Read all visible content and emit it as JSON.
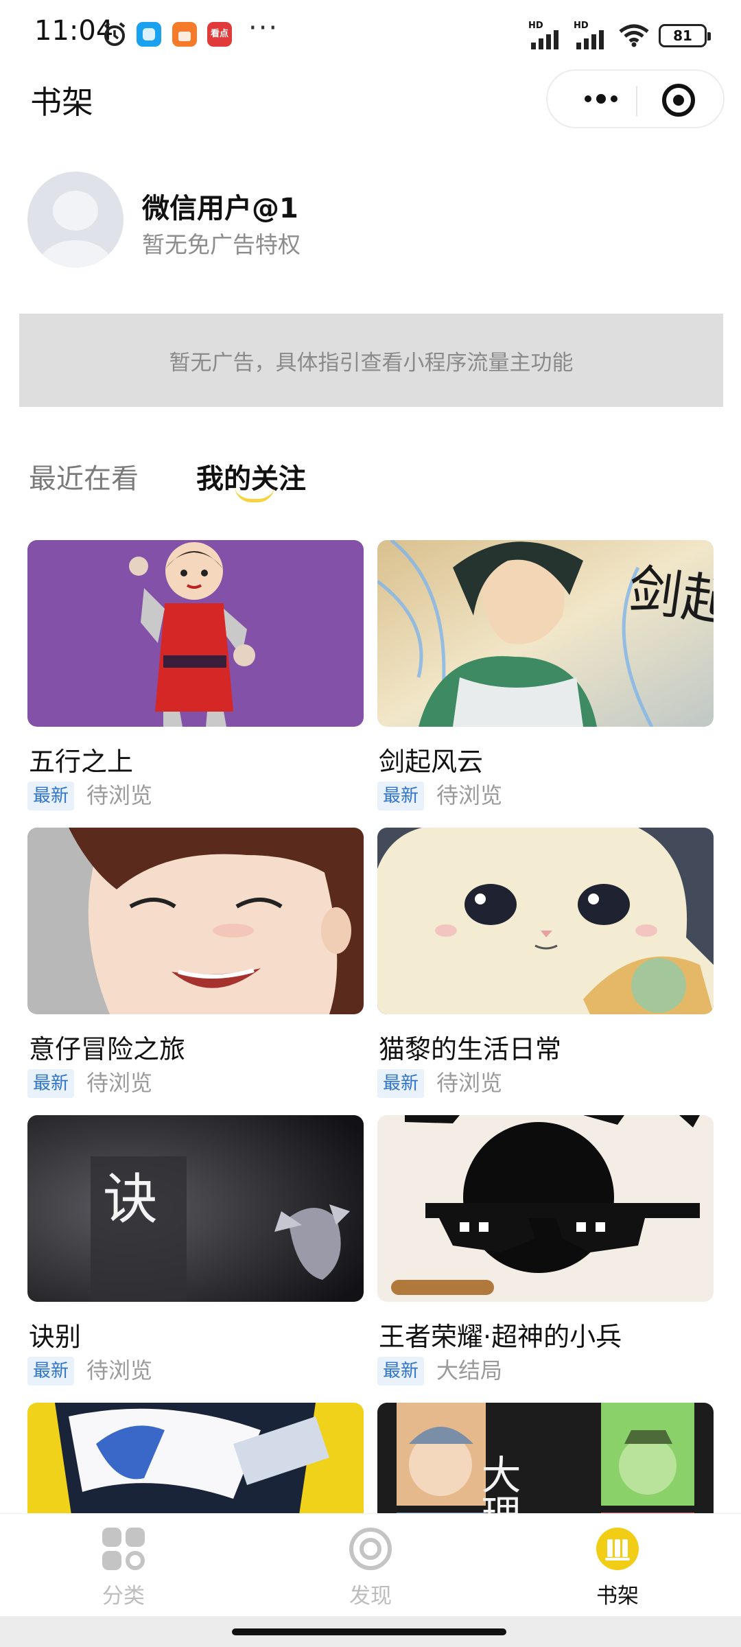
{
  "status_bar": {
    "time": "11:04",
    "battery": "81",
    "network_1": "HD",
    "network_2": "HD",
    "app_icons": [
      "alarm-icon",
      "app-blue-icon",
      "shopping-bag-icon",
      "kandian-app-icon"
    ],
    "kandian_label": "看点",
    "more": "···"
  },
  "header": {
    "title": "书架"
  },
  "profile": {
    "username": "微信用户@1",
    "privilege": "暂无免广告特权"
  },
  "ad_banner": {
    "text": "暂无广告，具体指引查看小程序流量主功能"
  },
  "tabs": [
    {
      "label": "最近在看",
      "active": false
    },
    {
      "label": "我的关注",
      "active": true
    }
  ],
  "books": [
    {
      "title": "五行之上",
      "badge": "最新",
      "status": "待浏览"
    },
    {
      "title": "剑起风云",
      "badge": "最新",
      "status": "待浏览"
    },
    {
      "title": "意仔冒险之旅",
      "badge": "最新",
      "status": "待浏览"
    },
    {
      "title": "猫黎的生活日常",
      "badge": "最新",
      "status": "待浏览"
    },
    {
      "title": "诀别",
      "badge": "最新",
      "status": "待浏览"
    },
    {
      "title": "王者荣耀·超神的小兵",
      "badge": "最新",
      "status": "大结局"
    }
  ],
  "cover_text": {
    "jian_qi": "剑起风",
    "jue_bie": "诀",
    "da_li_si": "大理寺"
  },
  "bottom_nav": [
    {
      "label": "分类",
      "icon": "grid-icon",
      "active": false
    },
    {
      "label": "发现",
      "icon": "target-icon",
      "active": false
    },
    {
      "label": "书架",
      "icon": "bookshelf-icon",
      "active": true
    }
  ],
  "colors": {
    "accent": "#f5d341",
    "badge_text": "#2f74c9",
    "badge_bg": "#e9f1fb",
    "inactive_nav": "#c4c4c4",
    "active_nav_icon": "#f2cd16"
  }
}
